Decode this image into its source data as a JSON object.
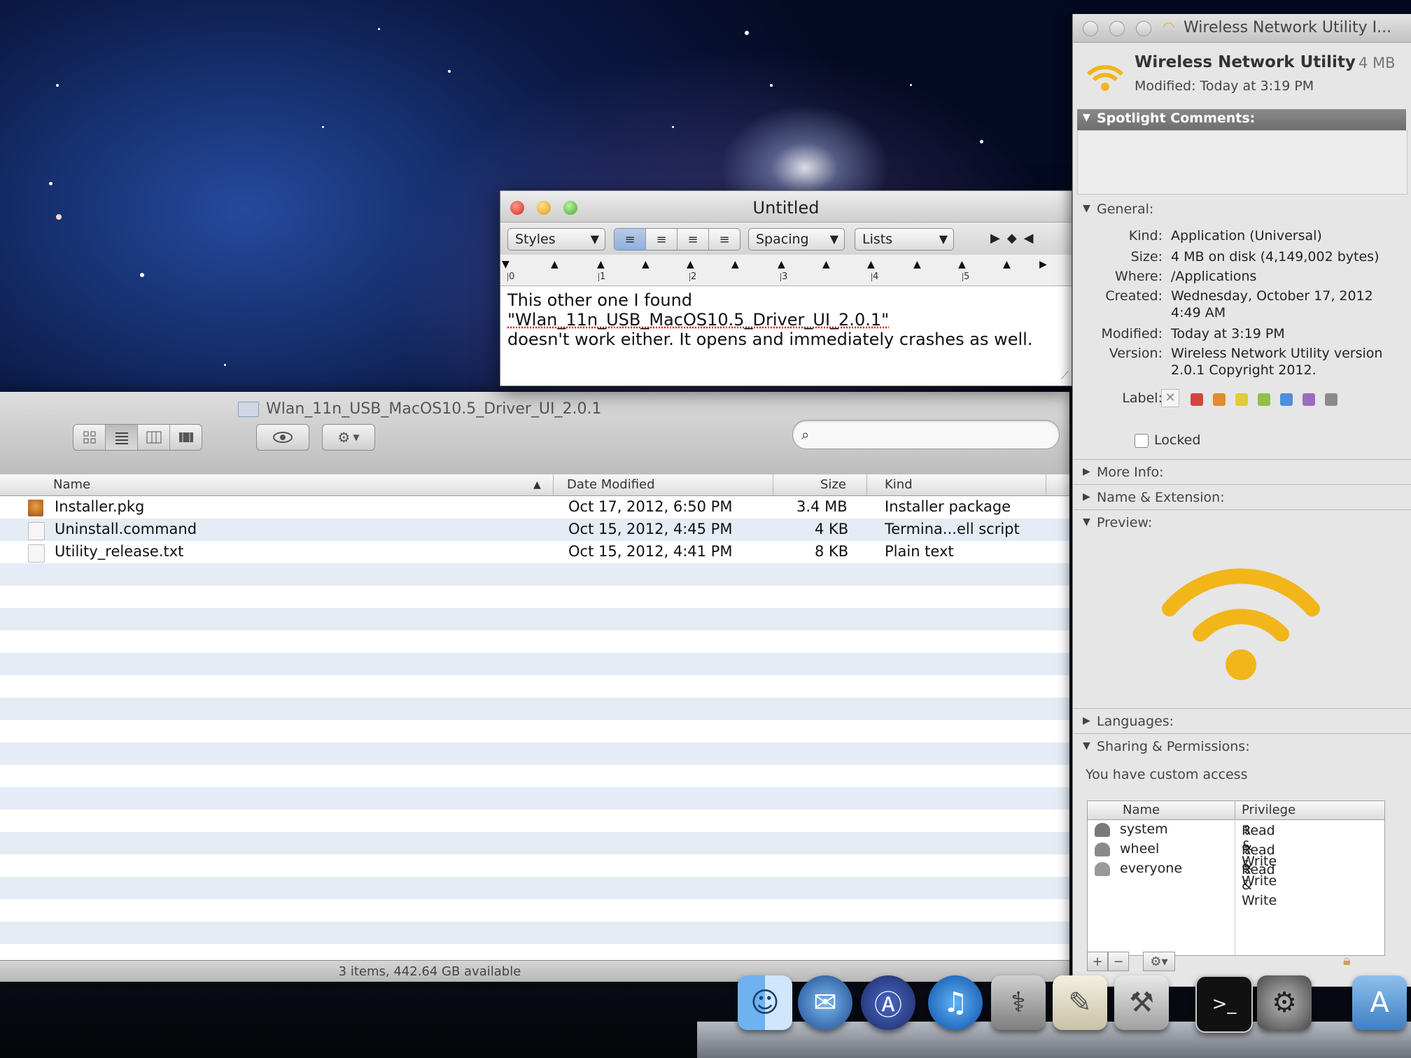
{
  "finder": {
    "title": "Wlan_11n_USB_MacOS10.5_Driver_UI_2.0.1",
    "view_buttons": [
      "icon-view",
      "list-view",
      "column-view",
      "coverflow-view"
    ],
    "search": {
      "placeholder": "",
      "value": ""
    },
    "columns": {
      "name": "Name",
      "date": "Date Modified",
      "size": "Size",
      "kind": "Kind"
    },
    "files": [
      {
        "name": "Installer.pkg",
        "date": "Oct 17, 2012, 6:50 PM",
        "size": "3.4 MB",
        "kind": "Installer package"
      },
      {
        "name": "Uninstall.command",
        "date": "Oct 15, 2012, 4:45 PM",
        "size": "4 KB",
        "kind": "Termina...ell script"
      },
      {
        "name": "Utility_release.txt",
        "date": "Oct 15, 2012, 4:41 PM",
        "size": "8 KB",
        "kind": "Plain text"
      }
    ],
    "status": "3 items, 442.64 GB available"
  },
  "textedit": {
    "title": "Untitled",
    "styles_label": "Styles",
    "spacing_label": "Spacing",
    "lists_label": "Lists",
    "ruler_numbers": [
      "0",
      "1",
      "2",
      "3",
      "4",
      "5"
    ],
    "body_line1": "This other one I found",
    "body_line2": "\"Wlan_11n_USB_MacOS10.5_Driver_UI_2.0.1\"",
    "body_line3": "doesn't work either. It opens and immediately crashes as well."
  },
  "info": {
    "window_title": "Wireless Network Utility I...",
    "app_name": "Wireless Network Utility",
    "app_size": "4 MB",
    "modified_line": "Modified: Today at 3:19 PM",
    "spotlight_label": "Spotlight Comments:",
    "general_label": "General:",
    "kind_k": "Kind:",
    "kind_v": "Application (Universal)",
    "size_k": "Size:",
    "size_v": "4 MB on disk (4,149,002 bytes)",
    "where_k": "Where:",
    "where_v": "/Applications",
    "created_k": "Created:",
    "created_v1": "Wednesday, October 17, 2012",
    "created_v2": "4:49 AM",
    "modified_k": "Modified:",
    "modified_v": "Today at 3:19 PM",
    "version_k": "Version:",
    "version_v1": "Wireless Network Utility version",
    "version_v2": "2.0.1 Copyright 2012.",
    "label_k": "Label:",
    "locked_label": "Locked",
    "more_info": "More Info:",
    "name_ext": "Name & Extension:",
    "preview": "Preview:",
    "languages": "Languages:",
    "sharing": "Sharing & Permissions:",
    "access_note": "You have custom access",
    "perm_headers": {
      "name": "Name",
      "privilege": "Privilege"
    },
    "permissions": [
      {
        "name": "system",
        "privilege": "Read & Write"
      },
      {
        "name": "wheel",
        "privilege": "Read & Write"
      },
      {
        "name": "everyone",
        "privilege": "Read & Write"
      }
    ],
    "label_colors": [
      "#d0463d",
      "#e28a2f",
      "#e0cc3a",
      "#8cc24a",
      "#4f8fd8",
      "#9b6bc0",
      "#8a8a8a"
    ],
    "wifi_color": "#f2b61a"
  },
  "dock": {
    "items": [
      "finder-icon",
      "thunderbird-icon",
      "xcode-icon",
      "itunes-icon",
      "disk-utility-icon",
      "textedit-icon",
      "instruments-icon",
      "terminal-icon",
      "system-preferences-icon",
      "applications-folder-icon"
    ]
  }
}
